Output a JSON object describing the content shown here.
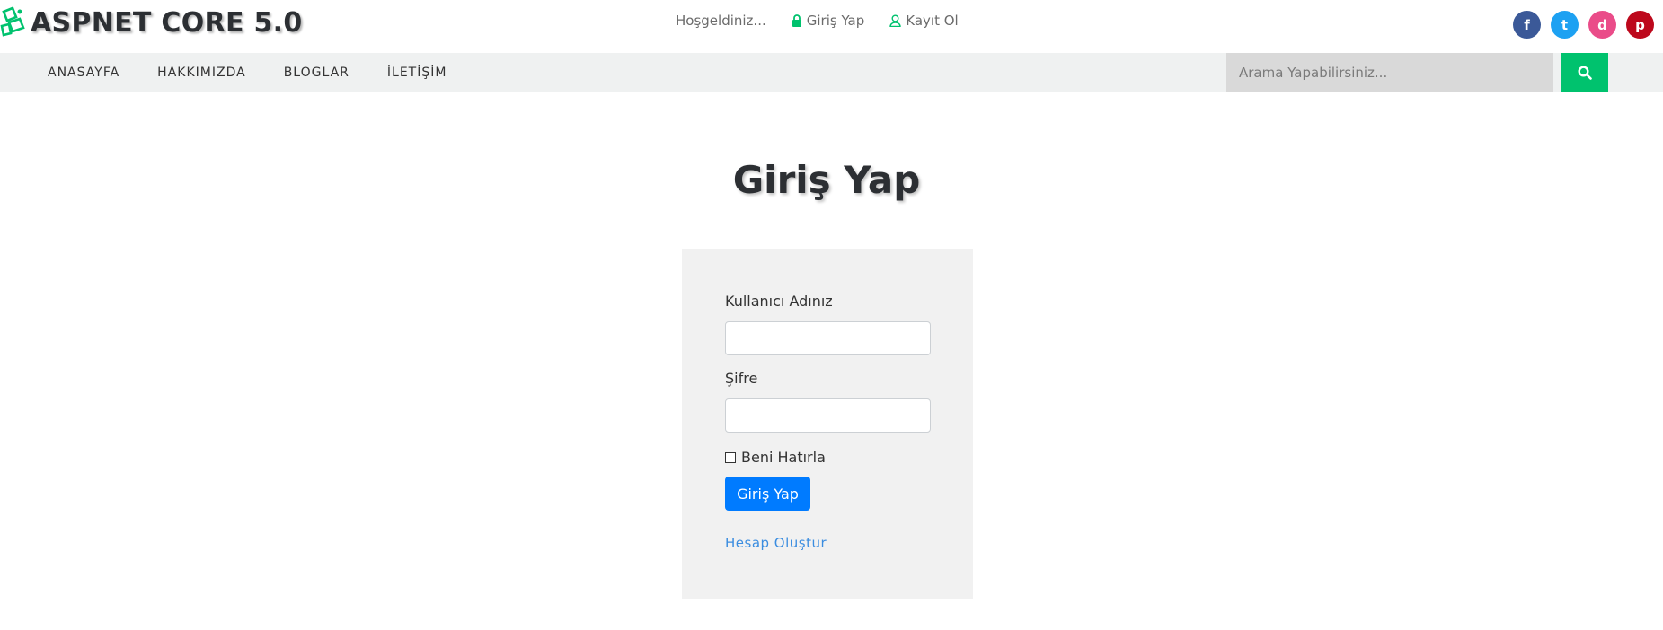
{
  "header": {
    "logo_text": "ASPNET CORE 5.0",
    "welcome": "Hoşgeldiniz...",
    "login_link": "Giriş Yap",
    "register_link": "Kayıt Ol",
    "socials": [
      {
        "name": "facebook",
        "glyph": "f",
        "color": "#3b5998"
      },
      {
        "name": "twitter",
        "glyph": "t",
        "color": "#1da1f2"
      },
      {
        "name": "dribbble",
        "glyph": "d",
        "color": "#ea4c89"
      },
      {
        "name": "pinterest",
        "glyph": "p",
        "color": "#bd081c"
      }
    ]
  },
  "nav": {
    "items": [
      "ANASAYFA",
      "HAKKIMIZDA",
      "BLOGLAR",
      "İLETİŞİM"
    ],
    "search_placeholder": "Arama Yapabilirsiniz..."
  },
  "main": {
    "title": "Giriş Yap",
    "form": {
      "username_label": "Kullanıcı Adınız",
      "username_value": "",
      "password_label": "Şifre",
      "password_value": "",
      "remember_label": "Beni Hatırla",
      "submit_label": "Giriş Yap",
      "create_account_link": "Hesap Oluştur"
    }
  },
  "colors": {
    "accent_green": "#00c26e",
    "primary_blue": "#007bff",
    "link_blue": "#3b8de0",
    "nav_bg": "#eff1f1",
    "card_bg": "#f1f1f1"
  }
}
